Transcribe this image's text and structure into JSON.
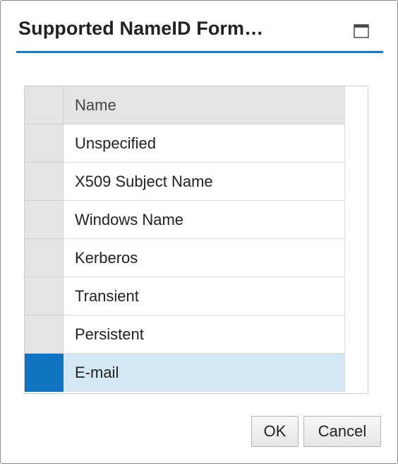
{
  "dialog": {
    "title": "Supported NameID Form…",
    "maximize_icon": "maximize-icon"
  },
  "table": {
    "column_header": "Name",
    "rows": [
      {
        "name": "Unspecified",
        "selected": false
      },
      {
        "name": "X509 Subject Name",
        "selected": false
      },
      {
        "name": "Windows Name",
        "selected": false
      },
      {
        "name": "Kerberos",
        "selected": false
      },
      {
        "name": "Transient",
        "selected": false
      },
      {
        "name": "Persistent",
        "selected": false
      },
      {
        "name": "E-mail",
        "selected": true
      }
    ]
  },
  "buttons": {
    "ok_label": "OK",
    "cancel_label": "Cancel"
  },
  "colors": {
    "accent": "#1a7bc4",
    "selection_marker": "#0f74c2",
    "selected_row": "#d3e7f5"
  }
}
